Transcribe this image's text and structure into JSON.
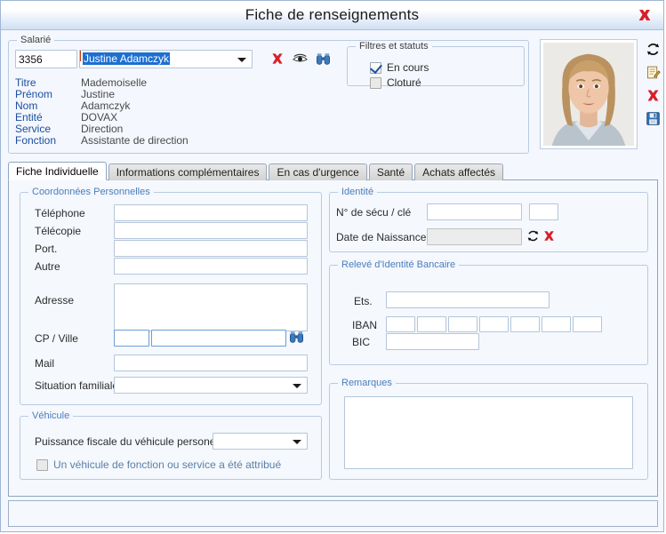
{
  "window": {
    "title": "Fiche de renseignements",
    "close_label": "×"
  },
  "colors": {
    "accent_blue": "#1a4fa0",
    "group_blue": "#4a7ebb",
    "selection_blue": "#1d6fd0",
    "danger_red": "#d81f26",
    "icon_blue": "#2f6fb5",
    "titlebar_gradient_end": "#cfdff3"
  },
  "employee_group": {
    "legend": "Salarié",
    "id_value": "3356",
    "name_value": "Justine Adamczyk",
    "name_selected": true,
    "actions": [
      {
        "name": "delete-employee-icon",
        "label": "Supprimer"
      },
      {
        "name": "view-employee-icon",
        "label": "Consulter"
      },
      {
        "name": "search-employee-icon",
        "label": "Rechercher"
      }
    ],
    "details": [
      {
        "label": "Titre",
        "value": "Mademoiselle"
      },
      {
        "label": "Prénom",
        "value": "Justine"
      },
      {
        "label": "Nom",
        "value": "Adamczyk"
      },
      {
        "label": "Entité",
        "value": "DOVAX"
      },
      {
        "label": "Service",
        "value": "Direction"
      },
      {
        "label": "Fonction",
        "value": "Assistante de direction"
      }
    ]
  },
  "filters_group": {
    "legend": "Filtres et statuts",
    "options": [
      {
        "label": "En cours",
        "checked": true
      },
      {
        "label": "Cloturé",
        "checked": false
      }
    ]
  },
  "photo_panel": {
    "alt": "Photo du salarié",
    "actions": [
      {
        "name": "refresh-photo-icon",
        "label": "Actualiser"
      },
      {
        "name": "edit-photo-icon",
        "label": "Modifier"
      },
      {
        "name": "delete-photo-icon",
        "label": "Supprimer"
      },
      {
        "name": "save-photo-icon",
        "label": "Enregistrer"
      }
    ]
  },
  "tabs": [
    {
      "label": "Fiche Individuelle",
      "active": true
    },
    {
      "label": "Informations complémentaires",
      "active": false
    },
    {
      "label": "En cas d'urgence",
      "active": false
    },
    {
      "label": "Santé",
      "active": false
    },
    {
      "label": "Achats affectés",
      "active": false
    }
  ],
  "coordonnees_group": {
    "legend": "Coordonnées Personnelles",
    "fields": [
      {
        "label": "Téléphone",
        "value": "",
        "placeholder": ""
      },
      {
        "label": "Télécopie",
        "value": "",
        "placeholder": ""
      },
      {
        "label": "Port.",
        "value": "",
        "placeholder": ""
      },
      {
        "label": "Autre",
        "value": "",
        "placeholder": ""
      }
    ],
    "address_label": "Adresse",
    "address_value": "",
    "cp_ville_label": "CP / Ville",
    "cp_value": "",
    "ville_value": "",
    "cp_search_icon": "binoculars-icon",
    "mail_label": "Mail",
    "mail_value": "",
    "situation_label": "Situation familiale",
    "situation_value": ""
  },
  "vehicule_group": {
    "legend": "Véhicule",
    "power_label": "Puissance fiscale du véhicule personel",
    "power_value": "",
    "company_vehicle_label": "Un véhicule de fonction ou service a été attribué",
    "company_vehicle_checked": false
  },
  "identite_group": {
    "legend": "Identité",
    "secu_label": "N° de sécu / clé",
    "secu_value": "",
    "secu_key_value": "",
    "birth_label": "Date de Naissance",
    "birth_value": "",
    "birth_actions": [
      {
        "name": "refresh-birthdate-icon",
        "label": "Actualiser"
      },
      {
        "name": "clear-birthdate-icon",
        "label": "Effacer"
      }
    ]
  },
  "rib_group": {
    "legend": "Relevé d'Identité Bancaire",
    "ets_label": "Ets.",
    "ets_value": "",
    "iban_label": "IBAN",
    "iban_segments": [
      "",
      "",
      "",
      "",
      "",
      "",
      ""
    ],
    "bic_label": "BIC",
    "bic_value": ""
  },
  "remarques_group": {
    "legend": "Remarques",
    "value": ""
  }
}
